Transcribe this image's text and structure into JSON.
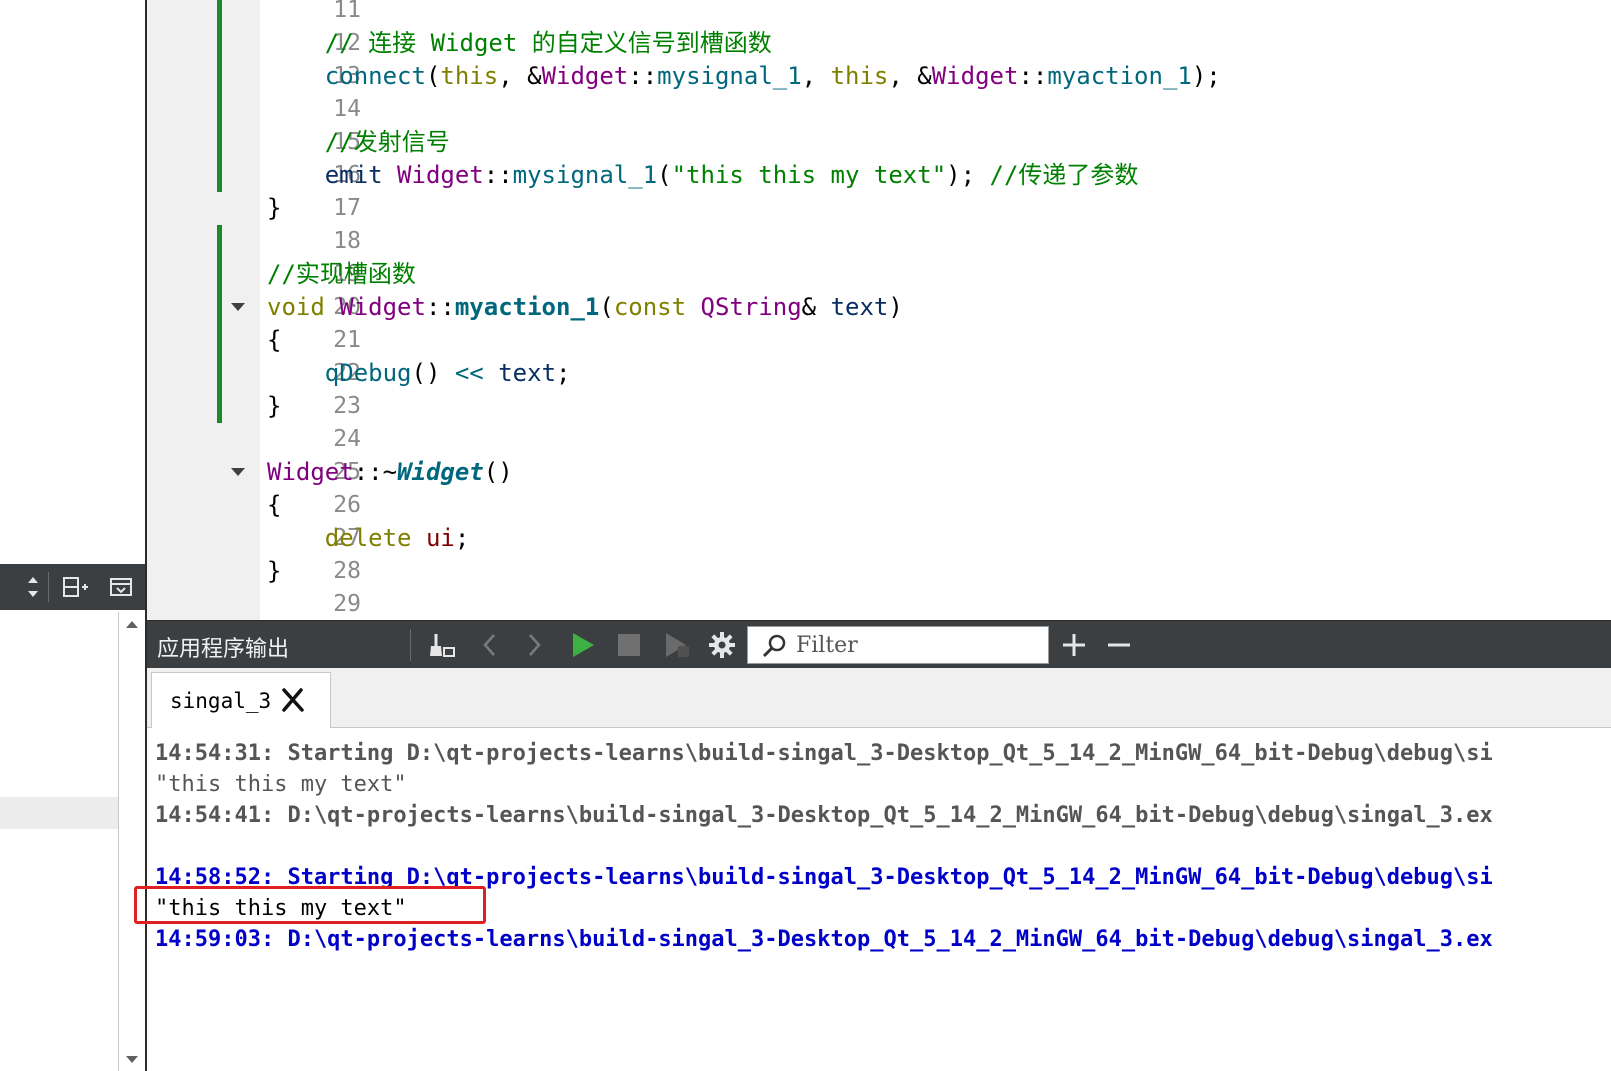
{
  "editor": {
    "lines": [
      {
        "num": "11",
        "parts": []
      },
      {
        "num": "12",
        "parts": [
          {
            "c": "com",
            "t": "    // 连接 Widget 的自定义信号到槽函数"
          }
        ]
      },
      {
        "num": "13",
        "parts": [
          {
            "c": "fn",
            "t": "    connect"
          },
          {
            "c": "punc",
            "t": "("
          },
          {
            "c": "kw",
            "t": "this"
          },
          {
            "c": "punc",
            "t": ", &"
          },
          {
            "c": "cls",
            "t": "Widget"
          },
          {
            "c": "punc",
            "t": "::"
          },
          {
            "c": "fn",
            "t": "mysignal_1"
          },
          {
            "c": "punc",
            "t": ", "
          },
          {
            "c": "kw",
            "t": "this"
          },
          {
            "c": "punc",
            "t": ", &"
          },
          {
            "c": "cls",
            "t": "Widget"
          },
          {
            "c": "punc",
            "t": "::"
          },
          {
            "c": "fn",
            "t": "myaction_1"
          },
          {
            "c": "punc",
            "t": ");"
          }
        ]
      },
      {
        "num": "14",
        "parts": []
      },
      {
        "num": "15",
        "parts": [
          {
            "c": "com",
            "t": "    //发射信号"
          }
        ]
      },
      {
        "num": "16",
        "parts": [
          {
            "c": "var",
            "t": "    emit "
          },
          {
            "c": "cls",
            "t": "Widget"
          },
          {
            "c": "punc",
            "t": "::"
          },
          {
            "c": "fn",
            "t": "mysignal_1"
          },
          {
            "c": "punc",
            "t": "("
          },
          {
            "c": "str",
            "t": "\"this this my text\""
          },
          {
            "c": "punc",
            "t": "); "
          },
          {
            "c": "com",
            "t": "//传递了参数"
          }
        ]
      },
      {
        "num": "17",
        "parts": [
          {
            "c": "punc",
            "t": "}"
          }
        ]
      },
      {
        "num": "18",
        "parts": []
      },
      {
        "num": "19",
        "parts": [
          {
            "c": "com",
            "t": "//实现槽函数"
          }
        ]
      },
      {
        "num": "20",
        "parts": [
          {
            "c": "kw",
            "t": "void "
          },
          {
            "c": "cls",
            "t": "Widget"
          },
          {
            "c": "punc",
            "t": "::"
          },
          {
            "c": "fnb",
            "t": "myaction_1"
          },
          {
            "c": "punc",
            "t": "("
          },
          {
            "c": "kw",
            "t": "const "
          },
          {
            "c": "cls",
            "t": "QString"
          },
          {
            "c": "punc",
            "t": "& "
          },
          {
            "c": "var",
            "t": "text"
          },
          {
            "c": "punc",
            "t": ")"
          }
        ]
      },
      {
        "num": "21",
        "parts": [
          {
            "c": "punc",
            "t": "{"
          }
        ]
      },
      {
        "num": "22",
        "parts": [
          {
            "c": "fn",
            "t": "    qDebug"
          },
          {
            "c": "punc",
            "t": "() "
          },
          {
            "c": "fn",
            "t": "<<"
          },
          {
            "c": "var",
            "t": " text"
          },
          {
            "c": "punc",
            "t": ";"
          }
        ]
      },
      {
        "num": "23",
        "parts": [
          {
            "c": "punc",
            "t": "}"
          }
        ]
      },
      {
        "num": "24",
        "parts": []
      },
      {
        "num": "25",
        "parts": [
          {
            "c": "cls",
            "t": "Widget"
          },
          {
            "c": "punc",
            "t": "::~"
          },
          {
            "c": "fnbi",
            "t": "Widget"
          },
          {
            "c": "punc",
            "t": "()"
          }
        ]
      },
      {
        "num": "26",
        "parts": [
          {
            "c": "punc",
            "t": "{"
          }
        ]
      },
      {
        "num": "27",
        "parts": [
          {
            "c": "kw",
            "t": "    delete "
          },
          {
            "c": "mem",
            "t": "ui"
          },
          {
            "c": "punc",
            "t": ";"
          }
        ]
      },
      {
        "num": "28",
        "parts": [
          {
            "c": "punc",
            "t": "}"
          }
        ]
      },
      {
        "num": "29",
        "parts": []
      }
    ]
  },
  "output_pane": {
    "title": "应用程序输出",
    "filter_placeholder": "Filter",
    "tab_label": "singal_3",
    "lines": [
      {
        "c": "gray-b",
        "t": "14:54:31: Starting D:\\qt-projects-learns\\build-singal_3-Desktop_Qt_5_14_2_MinGW_64_bit-Debug\\debug\\si"
      },
      {
        "c": "gray",
        "t": "\"this this my text\""
      },
      {
        "c": "gray-b",
        "t": "14:54:41: D:\\qt-projects-learns\\build-singal_3-Desktop_Qt_5_14_2_MinGW_64_bit-Debug\\debug\\singal_3.ex"
      },
      {
        "c": "plain",
        "t": ""
      },
      {
        "c": "blue-b",
        "t": "14:58:52: Starting D:\\qt-projects-learns\\build-singal_3-Desktop_Qt_5_14_2_MinGW_64_bit-Debug\\debug\\si"
      },
      {
        "c": "plain",
        "t": "\"this this my text\""
      },
      {
        "c": "blue-b",
        "t": "14:59:03: D:\\qt-projects-learns\\build-singal_3-Desktop_Qt_5_14_2_MinGW_64_bit-Debug\\debug\\singal_3.ex"
      }
    ]
  },
  "colors": {
    "change_bar": "#1b8a2a",
    "toolbar_bg": "#3c3f41",
    "highlight_box": "#e02020",
    "run_green": "#3cb043"
  },
  "icons": [
    "sort-updown-icon",
    "split-add-icon",
    "close-pane-icon",
    "clean-output-icon",
    "prev-arrow-icon",
    "next-arrow-icon",
    "run-icon",
    "stop-icon",
    "attach-debugger-icon",
    "gear-icon",
    "search-icon",
    "zoom-in-icon",
    "zoom-out-icon",
    "tab-close-icon",
    "scroll-up-icon",
    "scroll-down-icon"
  ]
}
